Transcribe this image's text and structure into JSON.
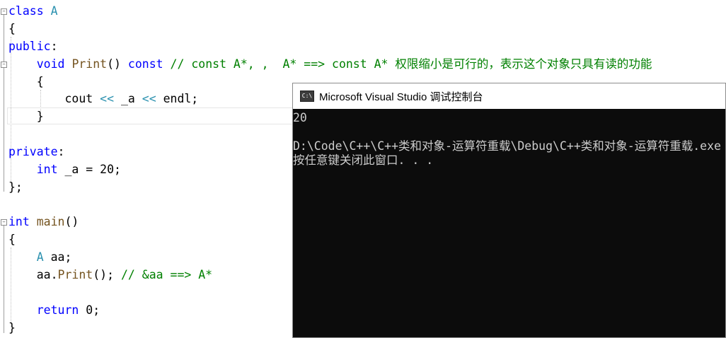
{
  "editor": {
    "lines": [
      {
        "segments": [
          {
            "cls": "kw",
            "text": "class"
          },
          {
            "cls": "plain",
            "text": " "
          },
          {
            "cls": "ty",
            "text": "A"
          }
        ]
      },
      {
        "segments": [
          {
            "cls": "plain",
            "text": "{"
          }
        ]
      },
      {
        "segments": [
          {
            "cls": "kw",
            "text": "public"
          },
          {
            "cls": "plain",
            "text": ":"
          }
        ]
      },
      {
        "segments": [
          {
            "cls": "plain",
            "text": "    "
          },
          {
            "cls": "kw",
            "text": "void"
          },
          {
            "cls": "plain",
            "text": " "
          },
          {
            "cls": "fn",
            "text": "Print"
          },
          {
            "cls": "plain",
            "text": "() "
          },
          {
            "cls": "kw",
            "text": "const"
          },
          {
            "cls": "plain",
            "text": " "
          },
          {
            "cls": "cm",
            "text": "// const A*, ,  A* ==> const A* 权限缩小是可行的，表示这个对象只具有读的功能"
          }
        ]
      },
      {
        "segments": [
          {
            "cls": "plain",
            "text": "    {"
          }
        ]
      },
      {
        "segments": [
          {
            "cls": "plain",
            "text": "        cout "
          },
          {
            "cls": "ty",
            "text": "<<"
          },
          {
            "cls": "plain",
            "text": " _a "
          },
          {
            "cls": "ty",
            "text": "<<"
          },
          {
            "cls": "plain",
            "text": " endl;"
          }
        ]
      },
      {
        "segments": [
          {
            "cls": "plain",
            "text": "    }"
          }
        ]
      },
      {
        "segments": []
      },
      {
        "segments": [
          {
            "cls": "kw",
            "text": "private"
          },
          {
            "cls": "plain",
            "text": ":"
          }
        ]
      },
      {
        "segments": [
          {
            "cls": "plain",
            "text": "    "
          },
          {
            "cls": "kw",
            "text": "int"
          },
          {
            "cls": "plain",
            "text": " _a = 20;"
          }
        ]
      },
      {
        "segments": [
          {
            "cls": "plain",
            "text": "};"
          }
        ]
      },
      {
        "segments": []
      },
      {
        "segments": [
          {
            "cls": "kw",
            "text": "int"
          },
          {
            "cls": "plain",
            "text": " "
          },
          {
            "cls": "fn",
            "text": "main"
          },
          {
            "cls": "plain",
            "text": "()"
          }
        ]
      },
      {
        "segments": [
          {
            "cls": "plain",
            "text": "{"
          }
        ]
      },
      {
        "segments": [
          {
            "cls": "plain",
            "text": "    "
          },
          {
            "cls": "ty",
            "text": "A"
          },
          {
            "cls": "plain",
            "text": " aa;"
          }
        ]
      },
      {
        "segments": [
          {
            "cls": "plain",
            "text": "    aa."
          },
          {
            "cls": "fn",
            "text": "Print"
          },
          {
            "cls": "plain",
            "text": "(); "
          },
          {
            "cls": "cm",
            "text": "// &aa ==> A*"
          }
        ]
      },
      {
        "segments": []
      },
      {
        "segments": [
          {
            "cls": "plain",
            "text": "    "
          },
          {
            "cls": "kw",
            "text": "return"
          },
          {
            "cls": "plain",
            "text": " 0;"
          }
        ]
      },
      {
        "segments": [
          {
            "cls": "plain",
            "text": "}"
          }
        ]
      }
    ]
  },
  "console": {
    "icon_label": "C:\\",
    "title": "Microsoft Visual Studio 调试控制台",
    "output": [
      "20",
      "",
      "D:\\Code\\C++\\C++类和对象-运算符重载\\Debug\\C++类和对象-运算符重载.exe",
      "按任意键关闭此窗口. . ."
    ]
  },
  "colors": {
    "keyword": "#0000ff",
    "type": "#2b91af",
    "comment": "#008000",
    "function": "#74531f",
    "console_bg": "#0c0c0c",
    "console_text": "#cccccc"
  }
}
